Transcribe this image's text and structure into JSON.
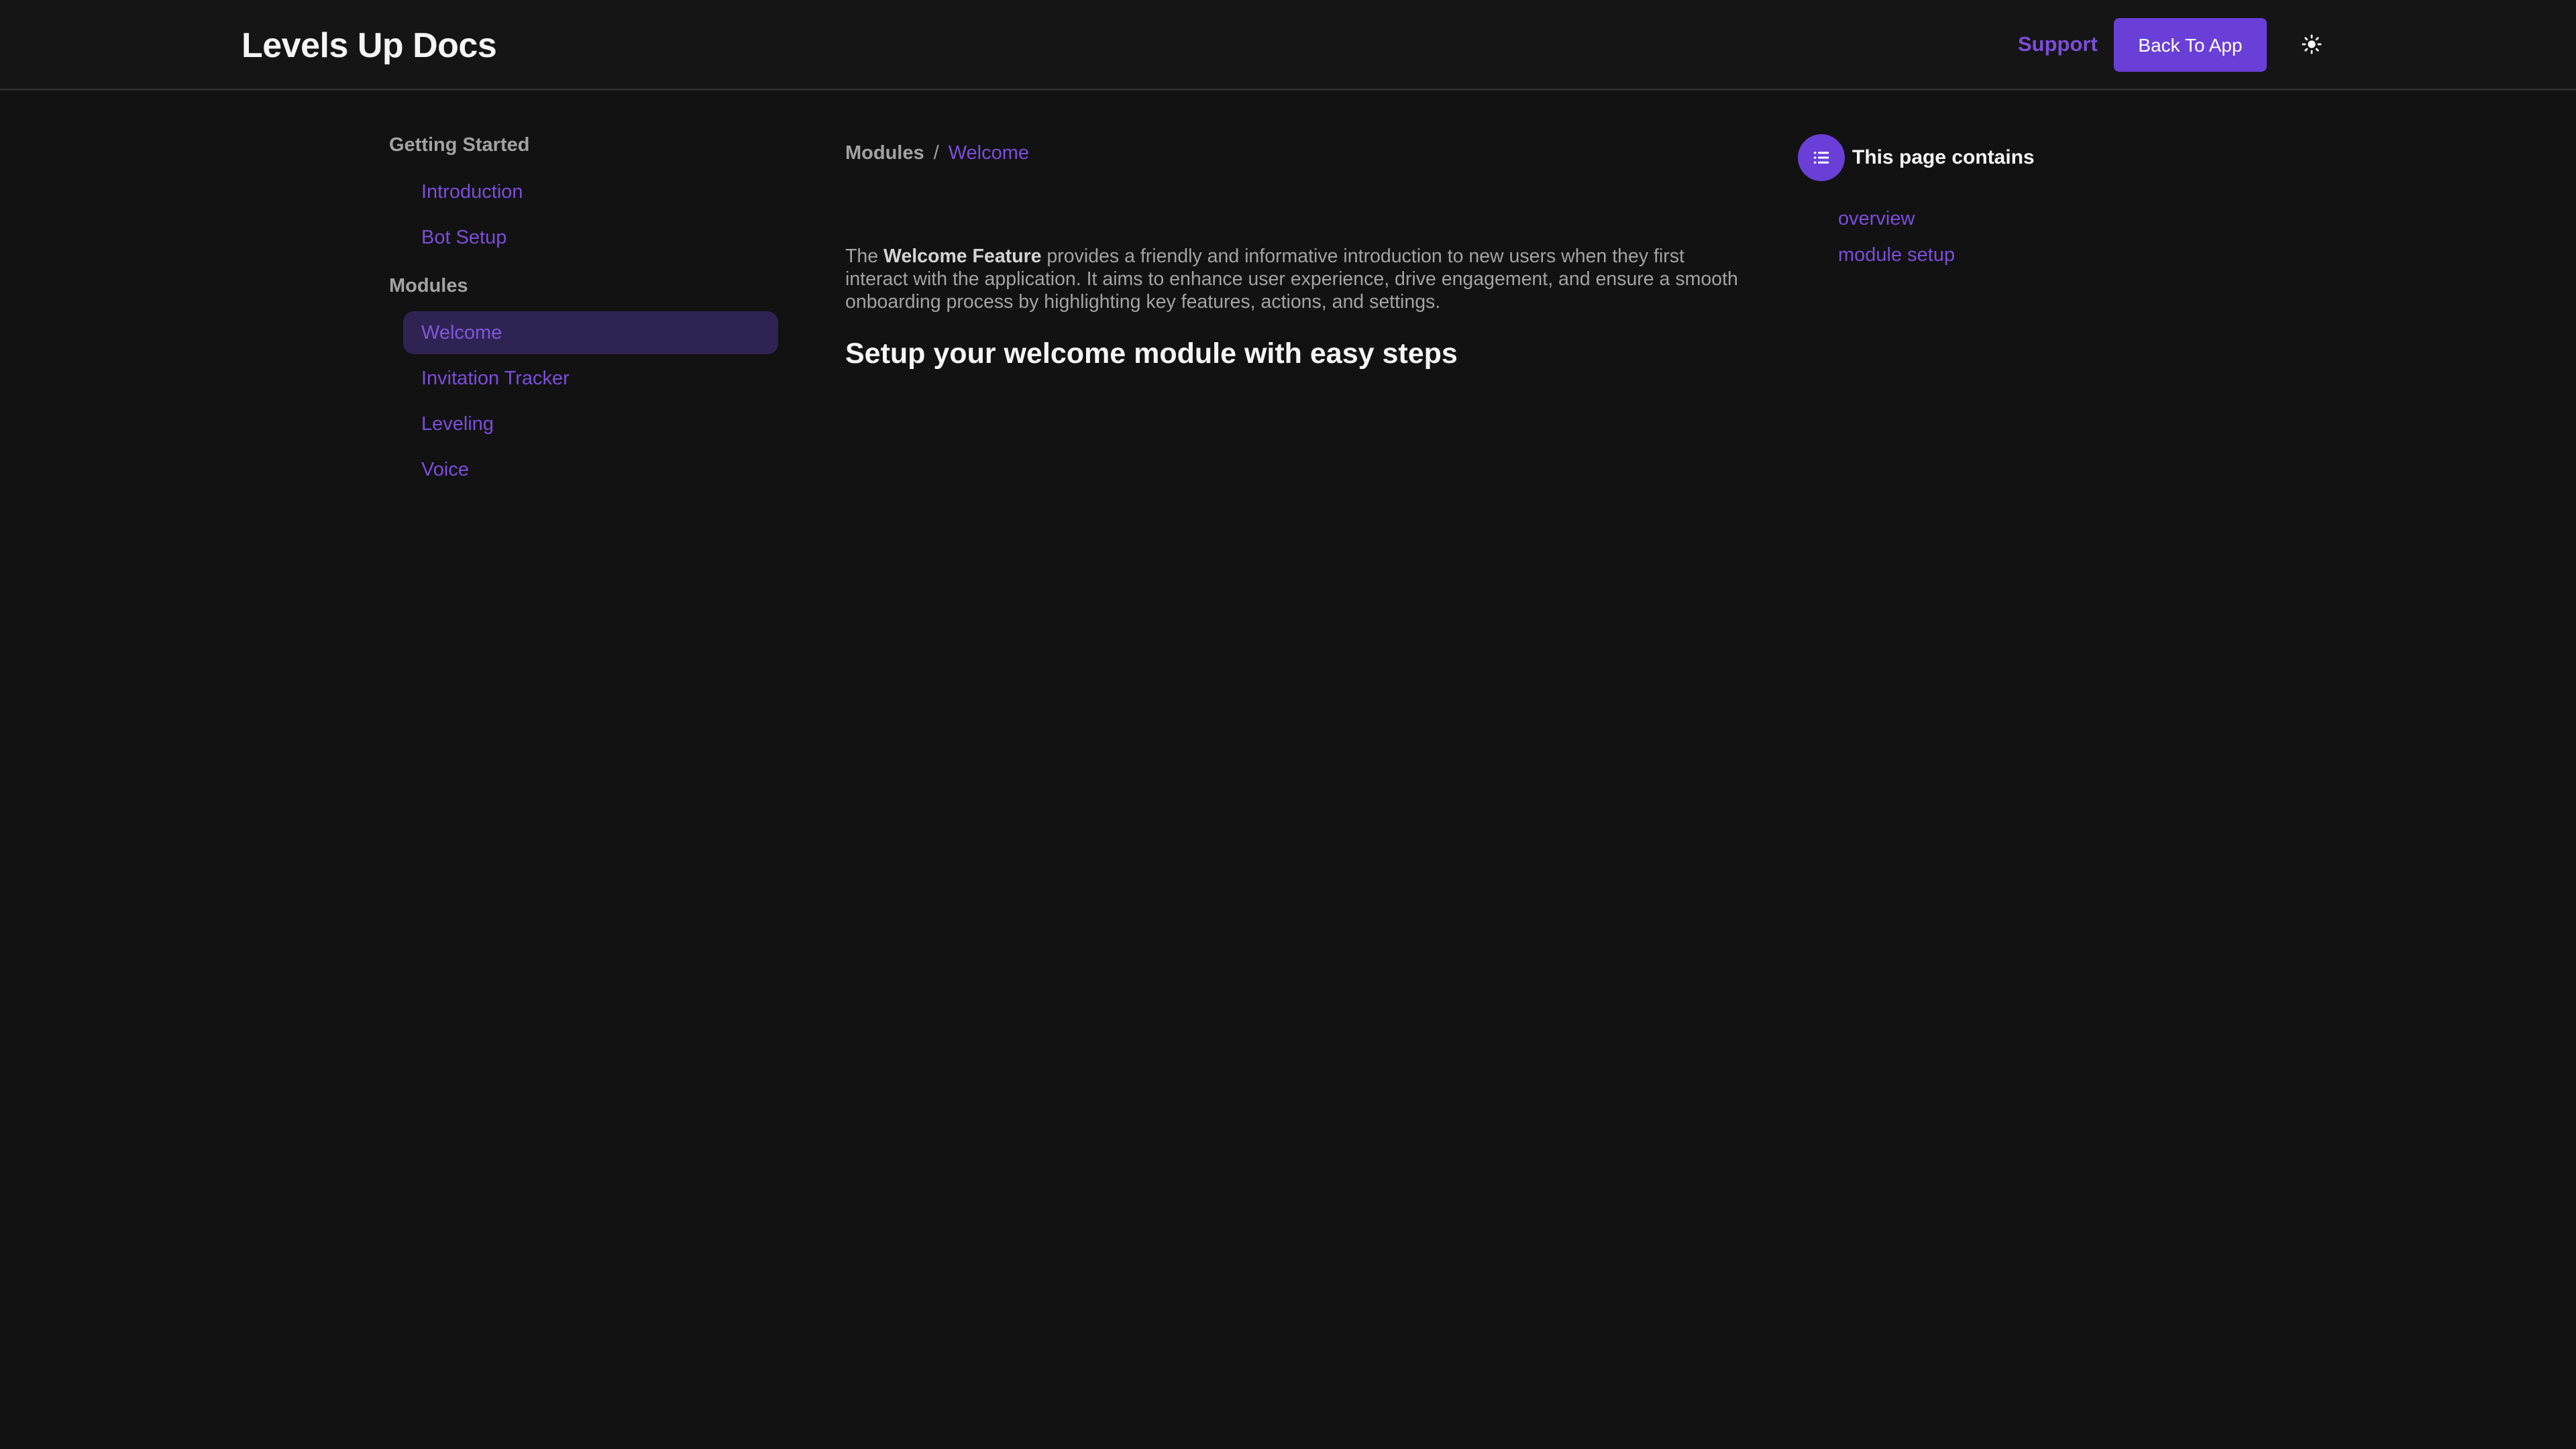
{
  "header": {
    "brand": "Levels Up Docs",
    "support_label": "Support",
    "back_button_label": "Back To App",
    "theme_toggle_icon": "sun-icon"
  },
  "sidebar": {
    "groups": [
      {
        "title": "Getting Started",
        "items": [
          {
            "label": "Introduction",
            "active": false
          },
          {
            "label": "Bot Setup",
            "active": false
          }
        ]
      },
      {
        "title": "Modules",
        "items": [
          {
            "label": "Welcome",
            "active": true
          },
          {
            "label": "Invitation Tracker",
            "active": false
          },
          {
            "label": "Leveling",
            "active": false
          },
          {
            "label": "Voice",
            "active": false
          }
        ]
      }
    ]
  },
  "breadcrumb": {
    "parent": "Modules",
    "separator": "/",
    "current": "Welcome"
  },
  "content": {
    "intro_prefix": "The ",
    "intro_bold": "Welcome Feature",
    "intro_rest": " provides a friendly and informative introduction to new users when they first interact with the application. It aims to enhance user experience, drive engagement, and ensure a smooth onboarding process by highlighting key features, actions, and settings.",
    "section_heading": "Setup your welcome module with easy steps"
  },
  "toc": {
    "icon": "list-icon",
    "title": "This page contains",
    "links": [
      "overview",
      "module setup"
    ]
  },
  "colors": {
    "background": "#121212",
    "header_background": "#151515",
    "accent": "#6a3fd7",
    "link": "#7c4ddc",
    "active_item_background": "#2f2354",
    "muted_text": "#a3a3a3",
    "heading_text": "#f5f5f5"
  }
}
